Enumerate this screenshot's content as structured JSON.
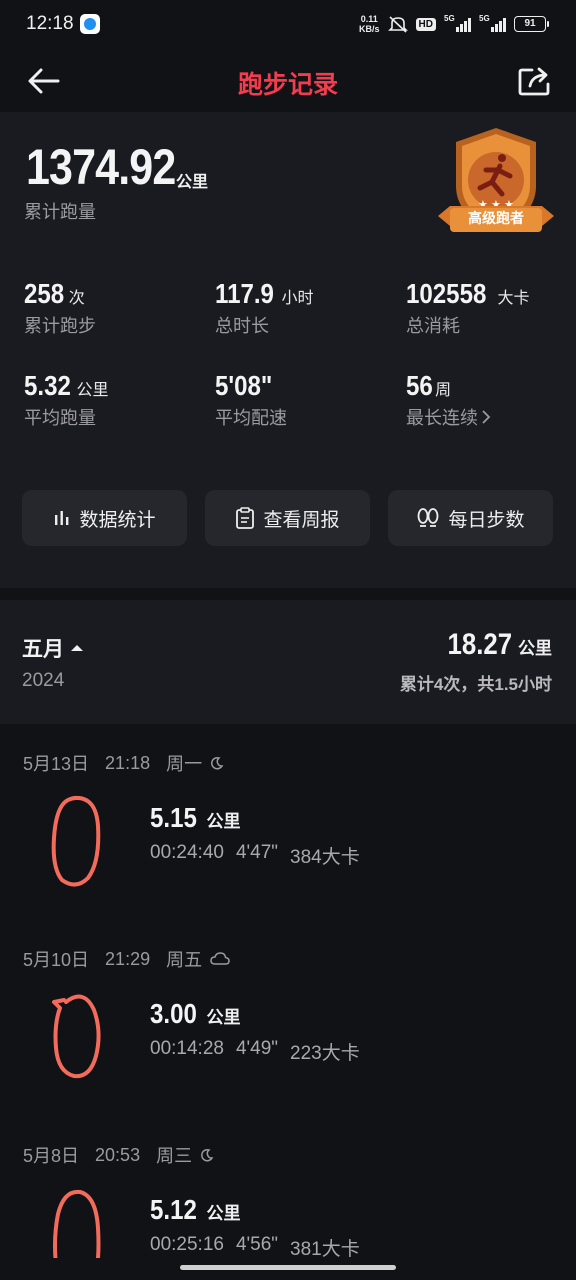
{
  "status": {
    "time": "12:18",
    "net_speed_value": "0.11",
    "net_speed_unit": "KB/s",
    "hd": "HD",
    "sig1": "5G",
    "sig2": "5G",
    "battery": "91"
  },
  "header": {
    "title": "跑步记录"
  },
  "summary": {
    "total_distance": "1374.92",
    "total_unit": "公里",
    "total_label": "累计跑量",
    "badge_label": "高级跑者",
    "stats": [
      {
        "value": "258",
        "unit": "次",
        "label": "累计跑步"
      },
      {
        "value": "117.9",
        "unit": "小时",
        "label": "总时长"
      },
      {
        "value": "102558",
        "unit": "大卡",
        "label": "总消耗"
      },
      {
        "value": "5.32",
        "unit": "公里",
        "label": "平均跑量"
      },
      {
        "value": "5'08\"",
        "unit": "",
        "label": "平均配速"
      },
      {
        "value": "56",
        "unit": "周",
        "label": "最长连续"
      }
    ],
    "actions": [
      {
        "label": "数据统计",
        "icon": "bar-chart-icon"
      },
      {
        "label": "查看周报",
        "icon": "clipboard-icon"
      },
      {
        "label": "每日步数",
        "icon": "footprints-icon"
      }
    ]
  },
  "month": {
    "name": "五月",
    "year": "2024",
    "distance": "18.27",
    "unit": "公里",
    "subtitle": "累计4次，共1.5小时"
  },
  "runs": [
    {
      "date": "5月13日",
      "time": "21:18",
      "weekday": "周一",
      "weather_icon": "moon-icon",
      "distance": "5.15",
      "unit": "公里",
      "duration": "00:24:40",
      "pace": "4'47\"",
      "calories": "384大卡"
    },
    {
      "date": "5月10日",
      "time": "21:29",
      "weekday": "周五",
      "weather_icon": "cloud-icon",
      "distance": "3.00",
      "unit": "公里",
      "duration": "00:14:28",
      "pace": "4'49\"",
      "calories": "223大卡"
    },
    {
      "date": "5月8日",
      "time": "20:53",
      "weekday": "周三",
      "weather_icon": "moon-icon",
      "distance": "5.12",
      "unit": "公里",
      "duration": "00:25:16",
      "pace": "4'56\"",
      "calories": "381大卡"
    }
  ],
  "colors": {
    "accent": "#f23d4f",
    "route": "#f26b5b",
    "badge": "#e8913a"
  }
}
